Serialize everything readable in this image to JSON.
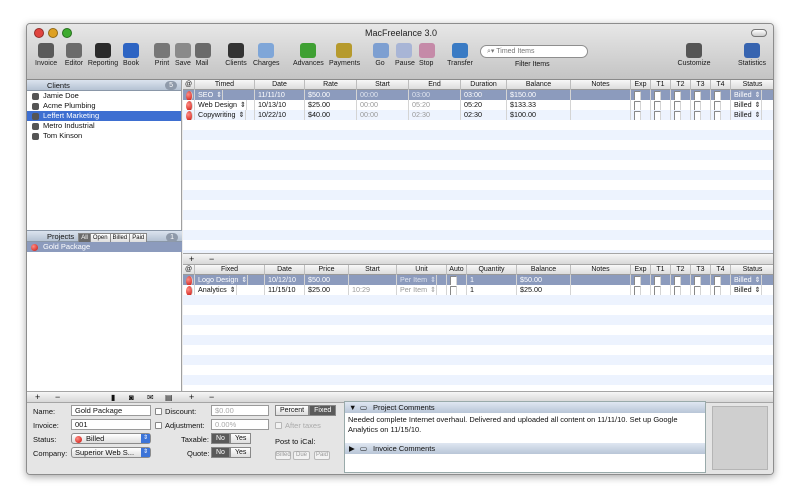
{
  "window": {
    "title": "MacFreelance 3.0"
  },
  "toolbar": {
    "items": [
      {
        "label": "Invoice",
        "icon": "invoice-icon",
        "color": "#5a5a5a"
      },
      {
        "label": "Editor",
        "icon": "editor-icon",
        "color": "#6b6b6b"
      },
      {
        "label": "Reporting",
        "icon": "reporting-icon",
        "color": "#2b2b2b"
      },
      {
        "label": "Book",
        "icon": "book-icon",
        "color": "#2d64c3"
      },
      {
        "label": "Print",
        "icon": "print-icon",
        "color": "#777777"
      },
      {
        "label": "Save",
        "icon": "save-icon",
        "color": "#8a8a8a"
      },
      {
        "label": "Mail",
        "icon": "mail-icon",
        "color": "#6a6a6a"
      },
      {
        "label": "Clients",
        "icon": "clients-icon",
        "color": "#333333"
      },
      {
        "label": "Charges",
        "icon": "charges-icon",
        "color": "#7fa6d8"
      },
      {
        "label": "Advances",
        "icon": "advances-icon",
        "color": "#3fa033"
      },
      {
        "label": "Payments",
        "icon": "payments-icon",
        "color": "#b69a2d"
      },
      {
        "label": "Go",
        "icon": "go-icon",
        "color": "#7d9fd1"
      },
      {
        "label": "Pause",
        "icon": "pause-icon",
        "color": "#a8b5d6"
      },
      {
        "label": "Stop",
        "icon": "stop-icon",
        "color": "#c58aa8"
      },
      {
        "label": "Transfer",
        "icon": "transfer-icon",
        "color": "#3a7bc4"
      },
      {
        "label": "Customize",
        "icon": "customize-icon",
        "color": "#555555"
      },
      {
        "label": "Statistics",
        "icon": "statistics-icon",
        "color": "#3764b0"
      }
    ],
    "search_placeholder": "Timed Items",
    "filter_label": "Filter Items"
  },
  "clients": {
    "header": "Clients",
    "count": "5",
    "items": [
      "Jamie Doe",
      "Acme Plumbing",
      "Leffert Marketing",
      "Metro Industrial",
      "Tom Kinson"
    ],
    "selected_index": 2
  },
  "projects": {
    "header": "Projects",
    "filters": [
      "All",
      "Open",
      "Billed",
      "Paid"
    ],
    "count": "1",
    "items": [
      "Gold Package"
    ]
  },
  "timed": {
    "headers": [
      "@",
      "Timed",
      "Date",
      "Rate",
      "Start",
      "End",
      "Duration",
      "Balance",
      "Notes",
      "Exp",
      "T1",
      "T2",
      "T3",
      "T4",
      "Status"
    ],
    "rows": [
      {
        "name": "SEO",
        "date": "11/11/10",
        "rate": "$50.00",
        "start": "00:00",
        "end": "03:00",
        "duration": "03:00",
        "balance": "$150.00",
        "status": "Billed"
      },
      {
        "name": "Web Design",
        "date": "10/13/10",
        "rate": "$25.00",
        "start": "00:00",
        "end": "05:20",
        "duration": "05:20",
        "balance": "$133.33",
        "status": "Billed"
      },
      {
        "name": "Copywriting",
        "date": "10/22/10",
        "rate": "$40.00",
        "start": "00:00",
        "end": "02:30",
        "duration": "02:30",
        "balance": "$100.00",
        "status": "Billed"
      }
    ]
  },
  "fixed": {
    "headers": [
      "@",
      "Fixed",
      "Date",
      "Price",
      "Start",
      "Unit",
      "Auto",
      "Quantity",
      "Balance",
      "Notes",
      "Exp",
      "T1",
      "T2",
      "T3",
      "T4",
      "Status"
    ],
    "rows": [
      {
        "name": "Logo Design",
        "date": "10/12/10",
        "price": "$50.00",
        "start": "",
        "unit": "Per Item",
        "qty": "1",
        "balance": "$50.00",
        "status": "Billed"
      },
      {
        "name": "Analytics",
        "date": "11/15/10",
        "price": "$25.00",
        "start": "10:29",
        "unit": "Per Item",
        "qty": "1",
        "balance": "$25.00",
        "status": "Billed"
      }
    ]
  },
  "form": {
    "name_label": "Name:",
    "name_value": "Gold Package",
    "invoice_label": "Invoice:",
    "invoice_value": "001",
    "status_label": "Status:",
    "status_value": "Billed",
    "company_label": "Company:",
    "company_value": "Superior Web S...",
    "discount_label": "Discount:",
    "discount_value": "$0.00",
    "adjustment_label": "Adjustment:",
    "adjustment_value": "0.00%",
    "percent_label": "Percent",
    "fixed_label": "Fixed",
    "after_taxes_label": "After taxes",
    "taxable_label": "Taxable:",
    "quote_label": "Quote:",
    "no_label": "No",
    "yes_label": "Yes",
    "post_label": "Post to iCal:",
    "ical_buttons": [
      "Billed",
      "Due",
      "Paid"
    ]
  },
  "comments": {
    "project_header": "Project Comments",
    "project_text": "Needed complete Internet overhaul. Delivered and uploaded all content on 11/11/10. Set up Google Analytics on 11/15/10.",
    "invoice_header": "Invoice Comments"
  },
  "plus_label": "+",
  "minus_label": "−"
}
